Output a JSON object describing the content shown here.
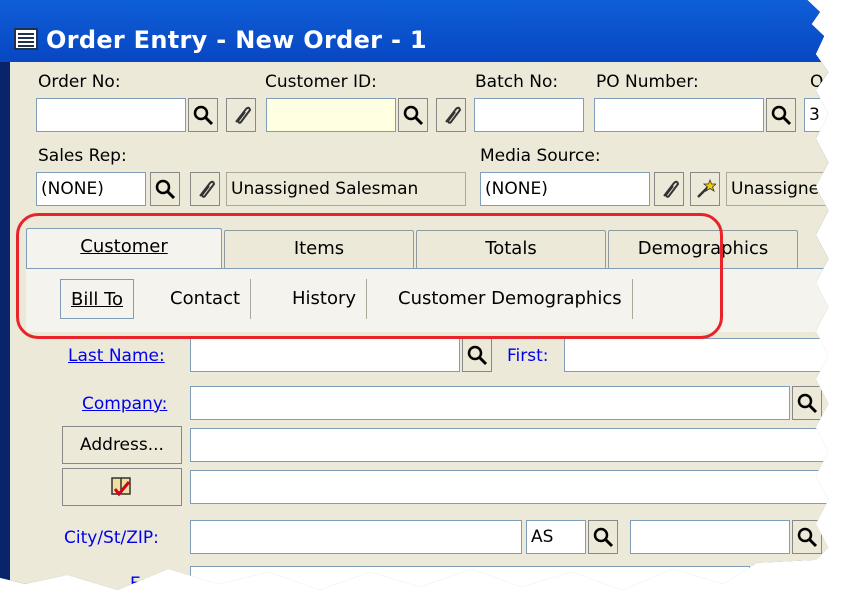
{
  "window": {
    "title": "Order Entry - New Order - 1"
  },
  "header": {
    "order_no_label": "Order No:",
    "customer_id_label": "Customer ID:",
    "batch_no_label": "Batch No:",
    "po_number_label": "PO Number:",
    "ord_label_partial": "Ord",
    "ord_value_partial": "3",
    "sales_rep_label": "Sales Rep:",
    "sales_rep_value": "(NONE)",
    "sales_rep_name": "Unassigned Salesman",
    "media_source_label": "Media Source:",
    "media_source_value": "(NONE)",
    "media_source_name": "Unassigne"
  },
  "tabs": [
    {
      "label": "Customer",
      "active": true
    },
    {
      "label": "Items",
      "active": false
    },
    {
      "label": "Totals",
      "active": false
    },
    {
      "label": "Demographics",
      "active": false
    }
  ],
  "subtabs": [
    {
      "label": "Bill To",
      "active": true
    },
    {
      "label": "Contact",
      "active": false
    },
    {
      "label": "History",
      "active": false
    },
    {
      "label": "Customer Demographics",
      "active": false
    }
  ],
  "form": {
    "last_name_label": "Last Name:",
    "first_label": "First:",
    "company_label": "Company:",
    "address_button": "Address...",
    "city_label": "City/St/ZIP:",
    "state_value": "AS",
    "email_label": "Email:"
  },
  "colors": {
    "title_bar": "#0a4fd0",
    "highlight": "#e8242a",
    "link_label": "#0000ee"
  }
}
